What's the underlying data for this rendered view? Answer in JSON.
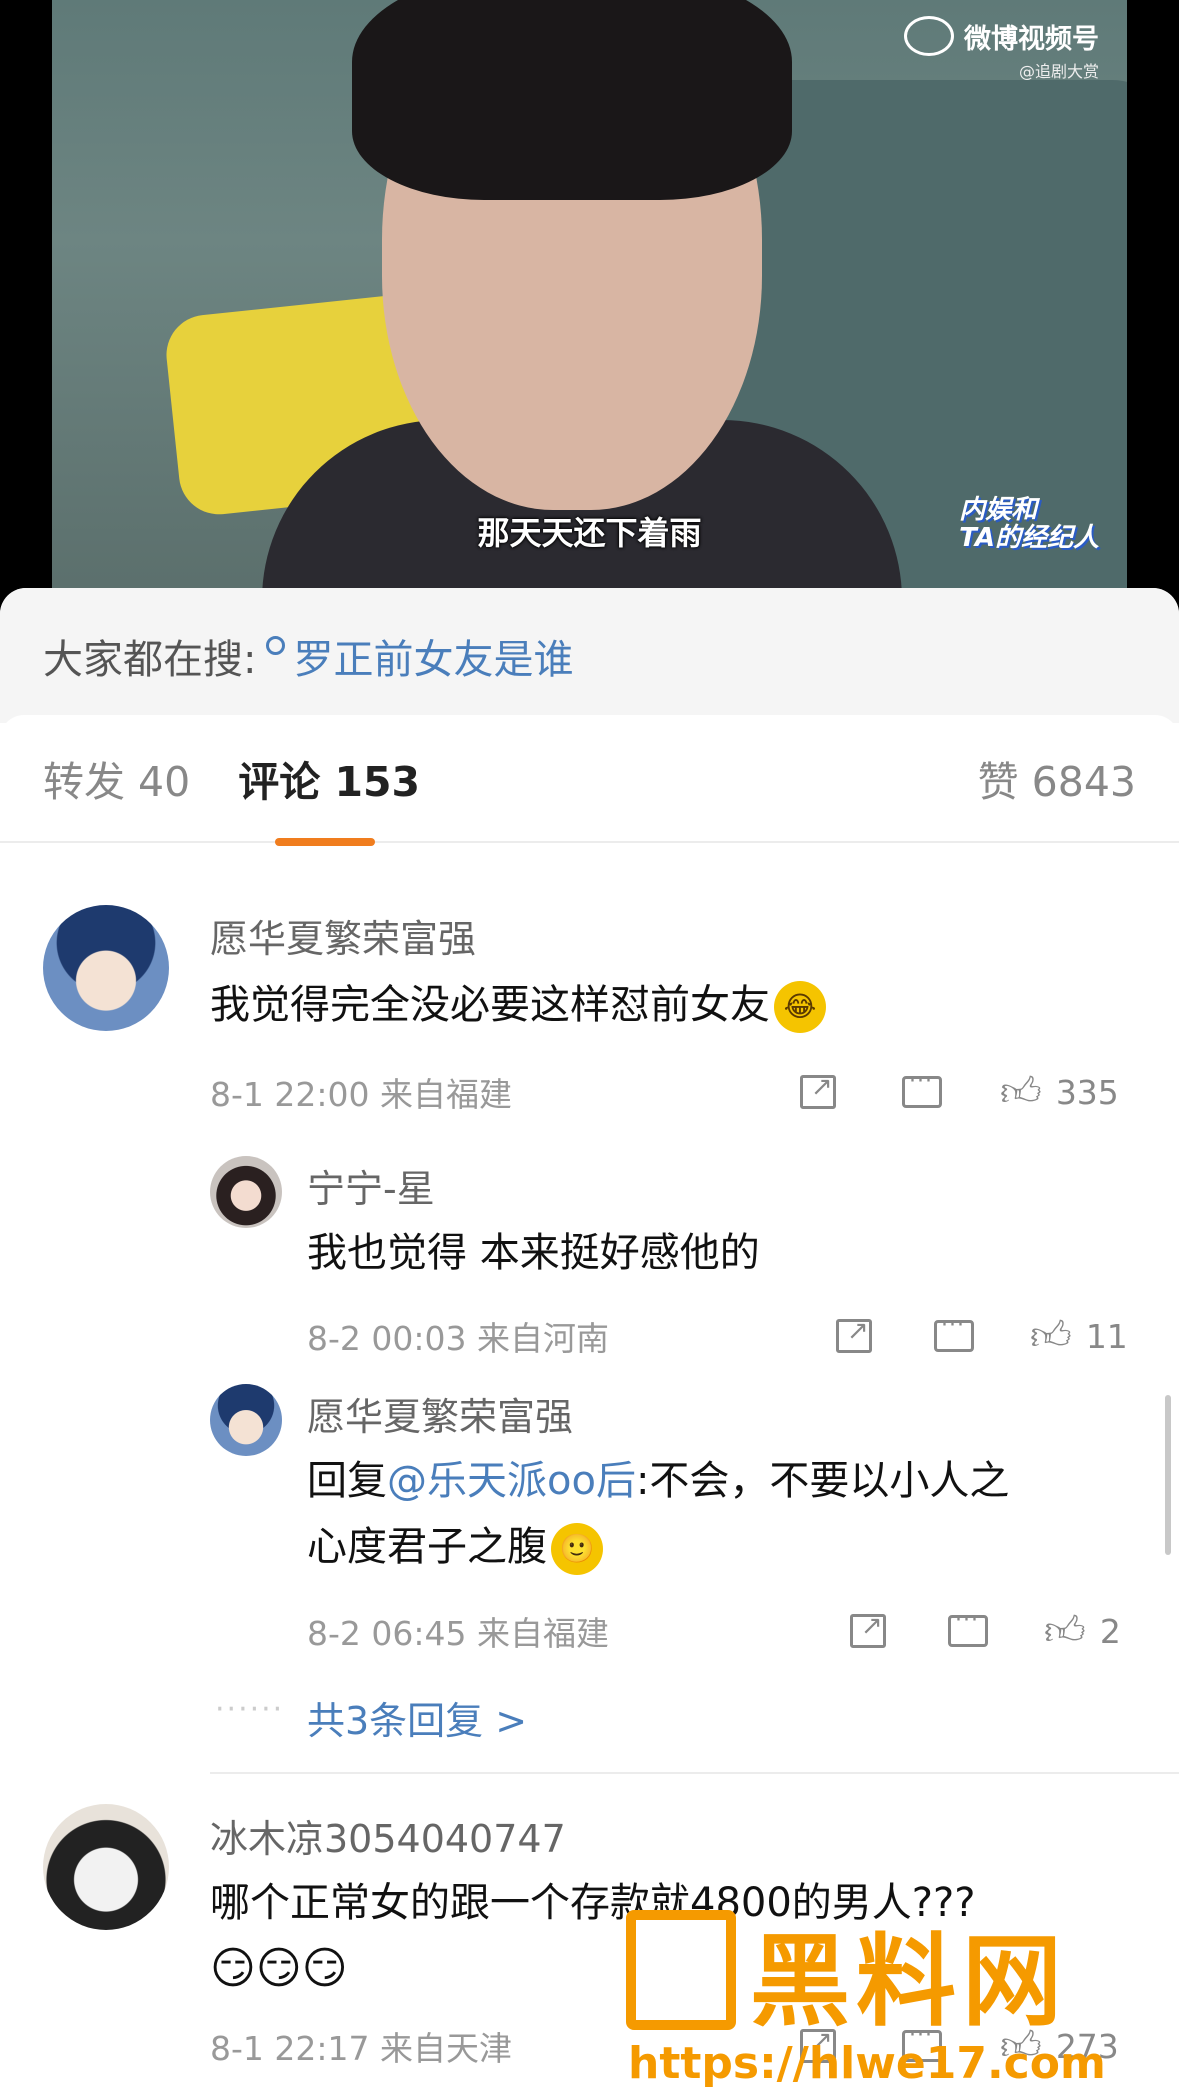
{
  "video": {
    "brand": "微博视频号",
    "channel": "@追剧大赏",
    "subtitle": "那天天还下着雨",
    "show_badge_line1": "内娱和",
    "show_badge_line2": "TA的经纪人"
  },
  "search": {
    "prefix": "大家都在搜:",
    "query": "罗正前女友是谁"
  },
  "tabs": {
    "repost": "转发 40",
    "comments": "评论 153",
    "likes": "赞 6843"
  },
  "comments": [
    {
      "name": "愿华夏繁荣富强",
      "text": "我觉得完全没必要这样怼前女友",
      "emoji": "😂",
      "time": "8-1 22:00",
      "location": "来自福建",
      "likes": "335",
      "replies": [
        {
          "name": "宁宁-星",
          "text": "我也觉得 本来挺好感他的",
          "time": "8-2 00:03",
          "location": "来自河南",
          "likes": "11"
        },
        {
          "name": "愿华夏繁荣富强",
          "reply_prefix": "回复",
          "mention": "@乐天派oo后",
          "text_line1": ":不会，不要以小人之",
          "text_line2": "心度君子之腹",
          "emoji": "🙂",
          "time": "8-2 06:45",
          "location": "来自福建",
          "likes": "2"
        }
      ],
      "more_replies": "共3条回复 >"
    },
    {
      "name": "冰木凉3054040747",
      "text": "哪个正常女的跟一个存款就4800的男人???",
      "emojis": "😏😏😏",
      "time": "8-1 22:17",
      "location": "来自天津",
      "likes": "273"
    }
  ],
  "watermark": {
    "title": "黑料网",
    "url": "https://hlwe17.com"
  },
  "colors": {
    "accent": "#f07d1e",
    "link": "#4a7ebb",
    "watermark": "#f59a00"
  }
}
